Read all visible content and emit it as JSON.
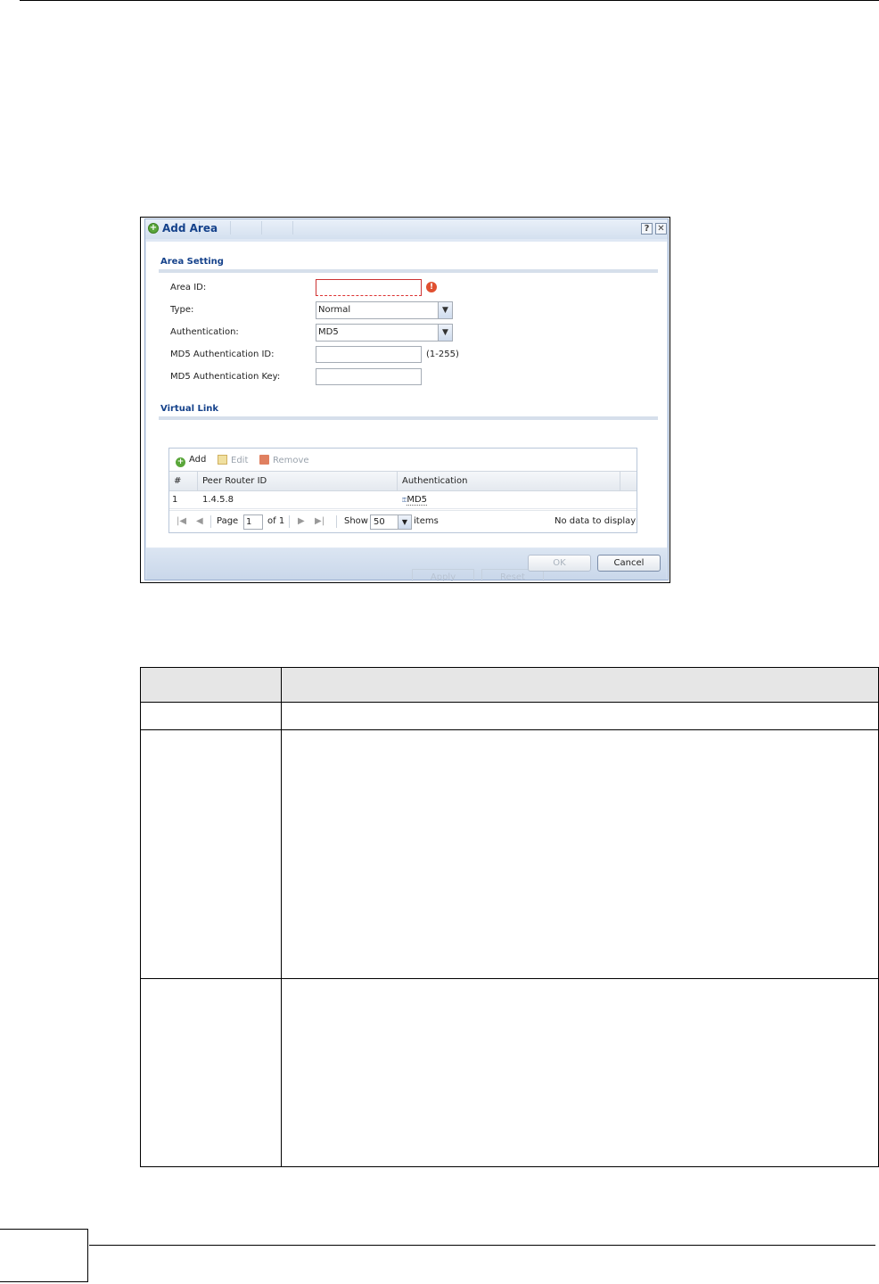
{
  "dialog": {
    "title": "Add Area",
    "ghost_tabs": [
      "",
      "",
      "",
      ""
    ],
    "area_setting": {
      "heading": "Area Setting",
      "area_id_label": "Area ID:",
      "type_label": "Type:",
      "type_value": "Normal",
      "authentication_label": "Authentication:",
      "authentication_value": "MD5",
      "md5_id_label": "MD5 Authentication ID:",
      "md5_id_hint": "(1-255)",
      "md5_key_label": "MD5 Authentication Key:"
    },
    "virtual_link": {
      "heading": "Virtual Link",
      "toolbar": {
        "add": "Add",
        "edit": "Edit",
        "remove": "Remove"
      },
      "columns": [
        "#",
        "Peer Router ID",
        "Authentication"
      ],
      "rows": [
        {
          "index": "1",
          "peer_router_id": "1.4.5.8",
          "authentication": "MD5"
        }
      ],
      "pager": {
        "page_label": "Page",
        "page_value": "1",
        "of_label": "of 1",
        "show_label": "Show",
        "show_value": "50",
        "items_label": "items",
        "status": "No data to display"
      }
    },
    "buttons": {
      "ok": "OK",
      "cancel": "Cancel",
      "ghost_apply": "Apply",
      "ghost_reset": "Reset"
    }
  }
}
